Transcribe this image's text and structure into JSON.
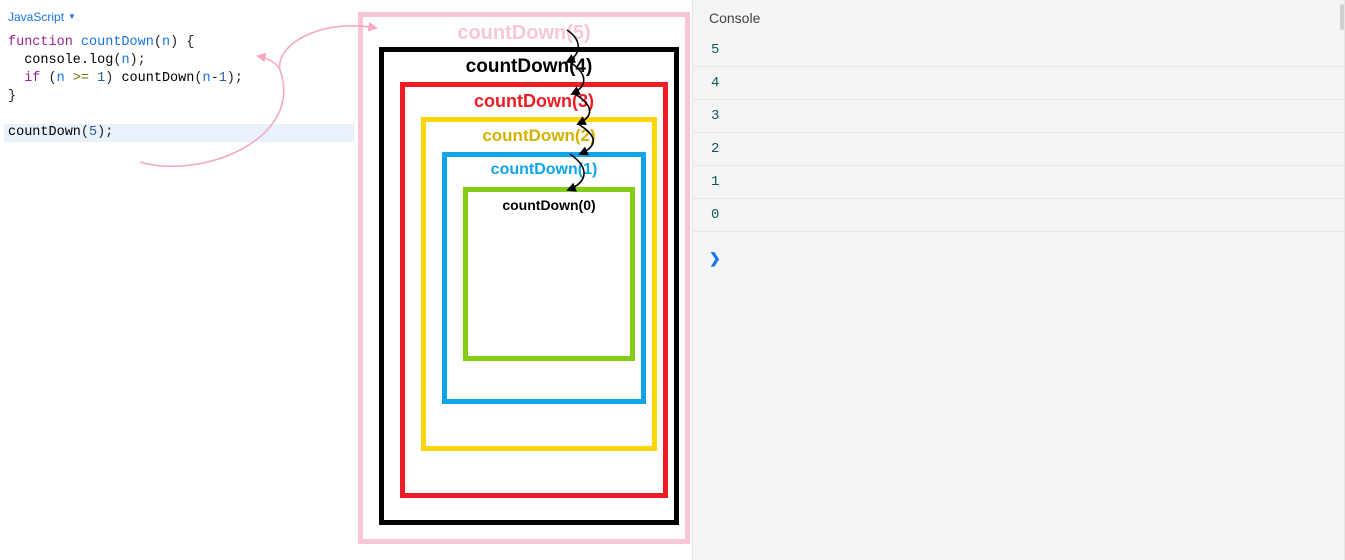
{
  "editor": {
    "language": "JavaScript",
    "code": {
      "line1_keyword": "function",
      "line1_name": "countDown",
      "line1_param": "n",
      "line1_open": " {",
      "line2_indent": "  ",
      "line2_call": "console.log",
      "line2_arg": "n",
      "line2_end": ";",
      "line3_indent": "  ",
      "line3_if": "if",
      "line3_open": " (",
      "line3_var": "n",
      "line3_op": " >= ",
      "line3_num": "1",
      "line3_close": ") ",
      "line3_call": "countDown",
      "line3_argopen": "(",
      "line3_argvar": "n",
      "line3_argminus": "-",
      "line3_argnum": "1",
      "line3_argclose": ")",
      "line3_end": ";",
      "line4_close": "}",
      "line6_call": "countDown",
      "line6_open": "(",
      "line6_num": "5",
      "line6_close": ")",
      "line6_end": ";"
    }
  },
  "diagram": {
    "frames": {
      "f5": "countDown(5)",
      "f4": "countDown(4)",
      "f3": "countDown(3)",
      "f2": "countDown(2)",
      "f1": "countDown(1)",
      "f0": "countDown(0)"
    },
    "colors": {
      "f5": "#f7c6d9",
      "f4": "#000000",
      "f3": "#ee1c25",
      "f2": "#ffd600",
      "f1": "#0ea5e9",
      "f0": "#84cc16"
    }
  },
  "console": {
    "title": "Console",
    "output": [
      "5",
      "4",
      "3",
      "2",
      "1",
      "0"
    ],
    "prompt": "❯"
  }
}
